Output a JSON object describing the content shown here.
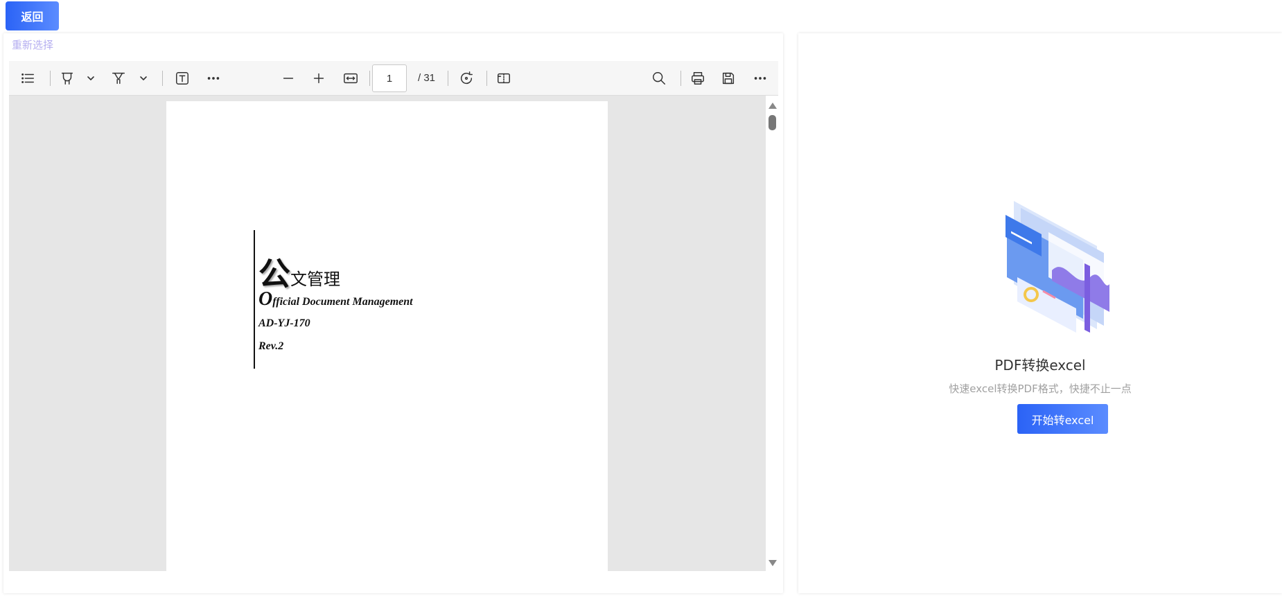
{
  "header": {
    "back_label": "返回"
  },
  "left": {
    "reselect_label": "重新选择",
    "toolbar": {
      "page_current": "1",
      "page_total": "/ 31",
      "icons": [
        "list-icon",
        "highlighter-icon",
        "chevron-down-icon",
        "underline-marker-icon",
        "chevron-down-icon",
        "text-box-icon",
        "more-icon",
        "zoom-out-icon",
        "zoom-in-icon",
        "fit-width-icon",
        "rotate-icon",
        "two-page-icon",
        "search-icon",
        "print-icon",
        "save-icon",
        "more-icon"
      ]
    },
    "document": {
      "title_big": "公",
      "title_rest": "文管理",
      "subtitle_cap": "O",
      "subtitle_rest": "fficial Document Management",
      "code": "AD-YJ-170",
      "revision": "Rev.2"
    }
  },
  "right": {
    "title": "PDF转换excel",
    "subtitle": "快速excel转换PDF格式，快捷不止一点",
    "start_label": "开始转excel"
  },
  "colors": {
    "accent": "#2b63f6",
    "accent_light": "#5b8cff",
    "reselect": "#b5aef0"
  }
}
